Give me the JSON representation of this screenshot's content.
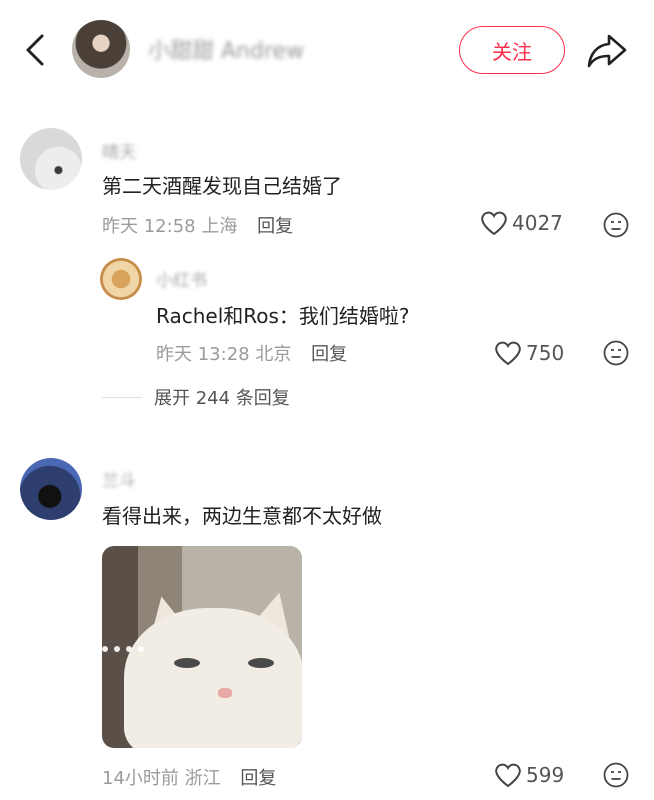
{
  "header": {
    "author_name": "小甜甜 Andrew",
    "follow_label": "关注"
  },
  "comments": [
    {
      "username": "晴天",
      "text": "第二天酒醒发现自己结婚了",
      "time": "昨天 12:58",
      "location": "上海",
      "reply_label": "回复",
      "likes": "4027",
      "replies": [
        {
          "username": "小红书",
          "text": "Rachel和Ros：我们结婚啦?",
          "time": "昨天 13:28",
          "location": "北京",
          "reply_label": "回复",
          "likes": "750"
        }
      ],
      "expand_label": "展开 244 条回复"
    },
    {
      "username": "兰斗",
      "text": "看得出来，两边生意都不太好做",
      "time": "14小时前",
      "location": "浙江",
      "reply_label": "回复",
      "likes": "599"
    }
  ],
  "colors": {
    "accent": "#ff2e4d",
    "meta": "#9b9b9b",
    "text": "#222222"
  },
  "icons": {
    "back": "chevron-left-icon",
    "share": "share-arrow-icon",
    "like": "heart-outline-icon",
    "dislike": "neutral-face-icon"
  }
}
